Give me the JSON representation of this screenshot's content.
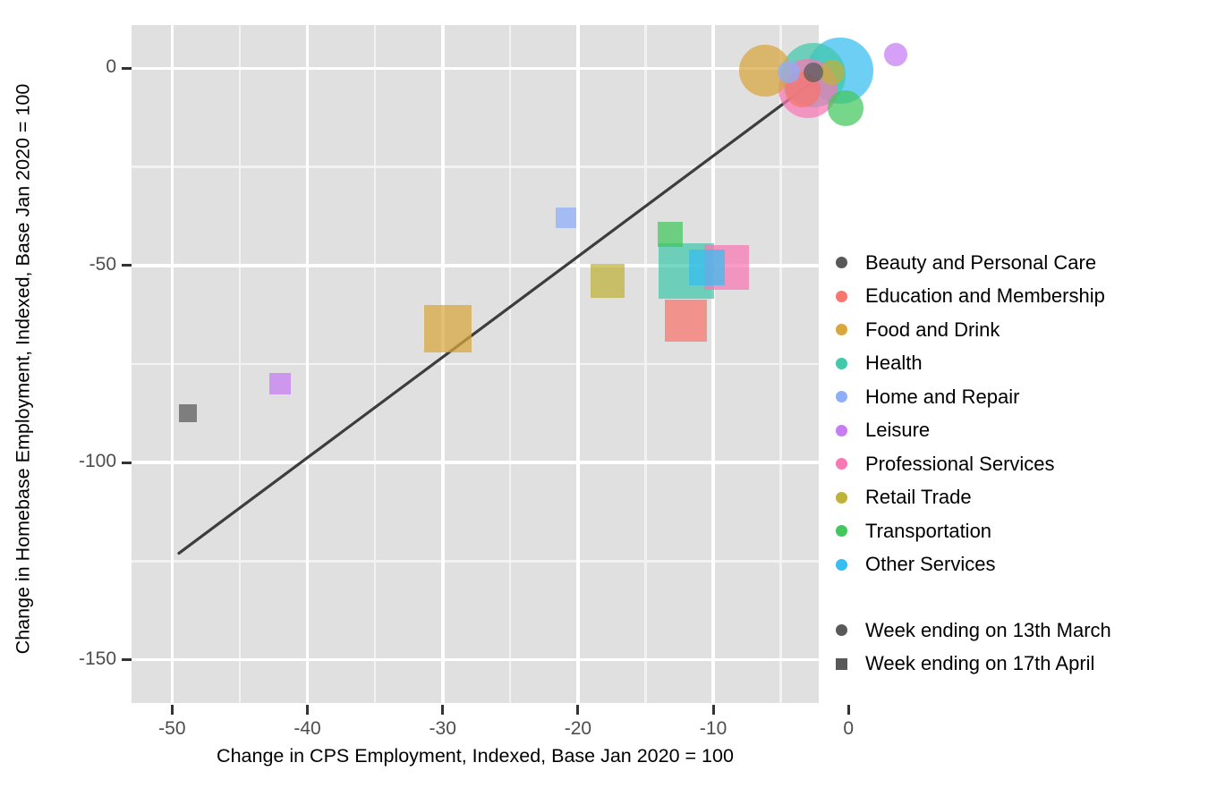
{
  "chart_data": {
    "type": "scatter",
    "title": "",
    "xlabel": "Change in CPS Employment, Indexed, Base Jan 2020 = 100",
    "ylabel": "Change in Homebase Employment, Indexed, Base Jan 2020 = 100",
    "xlim": [
      -53,
      -2.2
    ],
    "ylim": [
      -161,
      11
    ],
    "xticks": [
      -50,
      -40,
      -30,
      -20,
      -10,
      0
    ],
    "xtick_labels": [
      "-50",
      "-40",
      "-30",
      "-20",
      "-10",
      "0"
    ],
    "yticks": [
      0,
      -50,
      -100,
      -150
    ],
    "ytick_labels": [
      "0",
      "-50",
      "-100",
      "-150"
    ],
    "grid": true,
    "legend_position": "right",
    "reference_line": {
      "label": "45 degree line",
      "color": "#3d3d3d",
      "x": [
        -49.5,
        -1.5
      ],
      "y": [
        -123.0,
        -0.5
      ]
    },
    "size_encodes": "employment share (bubble area)",
    "shape_legend_title": "",
    "color_legend_title": "",
    "series": [
      {
        "name": "Beauty and Personal Care",
        "color": "#595959",
        "points": [
          {
            "shape": "circle",
            "x": -2.6,
            "y": -1.0,
            "size": 22
          },
          {
            "shape": "square",
            "x": -48.8,
            "y": -87.5,
            "size": 20
          }
        ]
      },
      {
        "name": "Education and Membership",
        "color": "#f8766d",
        "points": [
          {
            "shape": "circle",
            "x": -3.4,
            "y": -5.3,
            "size": 40
          },
          {
            "shape": "square",
            "x": -12.0,
            "y": -64.0,
            "size": 47
          }
        ]
      },
      {
        "name": "Food and Drink",
        "color": "#d9a73e",
        "points": [
          {
            "shape": "circle",
            "x": -6.2,
            "y": -0.5,
            "size": 58
          },
          {
            "shape": "square",
            "x": -29.6,
            "y": -66.0,
            "size": 53
          }
        ]
      },
      {
        "name": "Health",
        "color": "#42c8ab",
        "points": [
          {
            "shape": "circle",
            "x": -2.6,
            "y": -1.6,
            "size": 72
          },
          {
            "shape": "square",
            "x": -12.0,
            "y": -51.5,
            "size": 62
          }
        ]
      },
      {
        "name": "Home and Repair",
        "color": "#8eaefc",
        "points": [
          {
            "shape": "circle",
            "x": -4.4,
            "y": -1.0,
            "size": 25
          },
          {
            "shape": "square",
            "x": -20.9,
            "y": -38.0,
            "size": 23
          }
        ]
      },
      {
        "name": "Leisure",
        "color": "#c77cf4",
        "points": [
          {
            "shape": "circle",
            "x": 3.5,
            "y": 3.5,
            "size": 26
          },
          {
            "shape": "square",
            "x": -42.0,
            "y": -80.0,
            "size": 24
          }
        ]
      },
      {
        "name": "Professional Services",
        "color": "#f878b4",
        "points": [
          {
            "shape": "circle",
            "x": -3.0,
            "y": -5.0,
            "size": 66
          },
          {
            "shape": "square",
            "x": -9.0,
            "y": -50.5,
            "size": 50
          }
        ]
      },
      {
        "name": "Retail Trade",
        "color": "#bfb239",
        "points": [
          {
            "shape": "circle",
            "x": -1.2,
            "y": -1.0,
            "size": 28
          },
          {
            "shape": "square",
            "x": -17.8,
            "y": -54.0,
            "size": 38
          }
        ]
      },
      {
        "name": "Transportation",
        "color": "#42c75c",
        "points": [
          {
            "shape": "circle",
            "x": -0.2,
            "y": -10.0,
            "size": 40
          },
          {
            "shape": "square",
            "x": -13.2,
            "y": -42.0,
            "size": 28
          }
        ]
      },
      {
        "name": "Other Services",
        "color": "#37bdf2",
        "points": [
          {
            "shape": "circle",
            "x": -0.6,
            "y": -0.5,
            "size": 74
          },
          {
            "shape": "square",
            "x": -10.5,
            "y": -50.5,
            "size": 40
          }
        ]
      }
    ]
  },
  "legend": {
    "color_items": [
      {
        "label": "Beauty and Personal Care",
        "color": "#595959"
      },
      {
        "label": "Education and Membership",
        "color": "#f8766d"
      },
      {
        "label": "Food and Drink",
        "color": "#d9a73e"
      },
      {
        "label": "Health",
        "color": "#42c8ab"
      },
      {
        "label": "Home and Repair",
        "color": "#8eaefc"
      },
      {
        "label": "Leisure",
        "color": "#c77cf4"
      },
      {
        "label": "Professional Services",
        "color": "#f878b4"
      },
      {
        "label": "Retail Trade",
        "color": "#bfb239"
      },
      {
        "label": "Transportation",
        "color": "#42c75c"
      },
      {
        "label": "Other Services",
        "color": "#37bdf2"
      }
    ],
    "shape_items": [
      {
        "label": "Week ending on 13th March",
        "shape": "circle",
        "color": "#595959"
      },
      {
        "label": "Week ending on 17th April",
        "shape": "square",
        "color": "#595959"
      }
    ]
  },
  "theme": {
    "panel_background": "#e0e0e0",
    "gridline_major": "#ffffff",
    "gridline_minor": "#f2f2f2",
    "tick_label_color": "#4d4d4d",
    "axis_title_color": "#000000",
    "trendline_color": "#3d3d3d"
  }
}
